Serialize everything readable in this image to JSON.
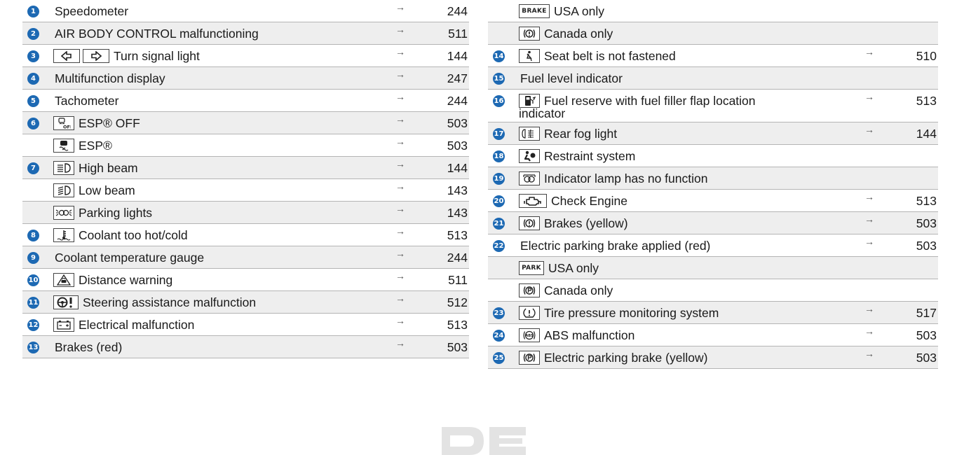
{
  "left": [
    {
      "num": "1",
      "label": "Speedometer",
      "page": "244",
      "shade": false,
      "icons": []
    },
    {
      "num": "2",
      "label": "AIR BODY CONTROL malfunctioning",
      "page": "511",
      "shade": true,
      "icons": []
    },
    {
      "num": "3",
      "label": "Turn signal light",
      "page": "144",
      "shade": false,
      "icons": [
        "turn-left-icon",
        "turn-right-icon"
      ]
    },
    {
      "num": "4",
      "label": "Multifunction display",
      "page": "247",
      "shade": true,
      "icons": []
    },
    {
      "num": "5",
      "label": "Tachometer",
      "page": "244",
      "shade": false,
      "icons": []
    },
    {
      "num": "6",
      "label": "ESP® OFF",
      "page": "503",
      "shade": true,
      "icons": [
        "esp-off-icon"
      ]
    },
    {
      "num": "",
      "label": "ESP®",
      "page": "503",
      "shade": false,
      "icons": [
        "esp-icon"
      ]
    },
    {
      "num": "7",
      "label": "High beam",
      "page": "144",
      "shade": true,
      "icons": [
        "high-beam-icon"
      ]
    },
    {
      "num": "",
      "label": "Low beam",
      "page": "143",
      "shade": false,
      "icons": [
        "low-beam-icon"
      ]
    },
    {
      "num": "",
      "label": "Parking lights",
      "page": "143",
      "shade": true,
      "icons": [
        "parking-lights-icon"
      ]
    },
    {
      "num": "8",
      "label": "Coolant too hot/cold",
      "page": "513",
      "shade": false,
      "icons": [
        "coolant-icon"
      ]
    },
    {
      "num": "9",
      "label": "Coolant temperature gauge",
      "page": "244",
      "shade": true,
      "icons": []
    },
    {
      "num": "10",
      "label": "Distance warning",
      "page": "511",
      "shade": false,
      "icons": [
        "distance-warning-icon"
      ]
    },
    {
      "num": "11",
      "label": "Steering assistance malfunction",
      "page": "512",
      "shade": true,
      "icons": [
        "steering-icon"
      ]
    },
    {
      "num": "12",
      "label": "Electrical malfunction",
      "page": "513",
      "shade": false,
      "icons": [
        "battery-icon"
      ]
    },
    {
      "num": "13",
      "label": "Brakes (red)",
      "page": "503",
      "shade": true,
      "icons": []
    }
  ],
  "right": [
    {
      "num": "",
      "label": "USA only",
      "page": "",
      "shade": false,
      "icons": [
        "brake-text-icon"
      ]
    },
    {
      "num": "",
      "label": "Canada only",
      "page": "",
      "shade": true,
      "icons": [
        "brake-circle-icon"
      ]
    },
    {
      "num": "14",
      "label": "Seat belt is not fastened",
      "page": "510",
      "shade": false,
      "icons": [
        "seat-belt-icon"
      ]
    },
    {
      "num": "15",
      "label": "Fuel level indicator",
      "page": "",
      "shade": true,
      "icons": []
    },
    {
      "num": "16",
      "label": "Fuel reserve with fuel filler flap location",
      "label2": "indicator",
      "page": "513",
      "shade": false,
      "icons": [
        "fuel-icon"
      ]
    },
    {
      "num": "17",
      "label": "Rear fog light",
      "page": "144",
      "shade": true,
      "icons": [
        "rear-fog-icon"
      ]
    },
    {
      "num": "18",
      "label": "Restraint system",
      "page": "",
      "shade": false,
      "icons": [
        "restraint-icon"
      ]
    },
    {
      "num": "19",
      "label": "Indicator lamp has no function",
      "page": "",
      "shade": true,
      "icons": [
        "indicator-lamp-icon"
      ]
    },
    {
      "num": "20",
      "label": "Check Engine",
      "page": "513",
      "shade": false,
      "icons": [
        "engine-icon"
      ]
    },
    {
      "num": "21",
      "label": "Brakes (yellow)",
      "page": "503",
      "shade": true,
      "icons": [
        "brake-circle-icon"
      ]
    },
    {
      "num": "22",
      "label": "Electric parking brake applied (red)",
      "page": "503",
      "shade": false,
      "icons": []
    },
    {
      "num": "",
      "label": "USA only",
      "page": "",
      "shade": true,
      "icons": [
        "park-text-icon"
      ]
    },
    {
      "num": "",
      "label": "Canada only",
      "page": "",
      "shade": false,
      "icons": [
        "park-circle-icon"
      ]
    },
    {
      "num": "23",
      "label": "Tire pressure monitoring system",
      "page": "517",
      "shade": true,
      "icons": [
        "tire-pressure-icon"
      ]
    },
    {
      "num": "24",
      "label": "ABS malfunction",
      "page": "503",
      "shade": false,
      "icons": [
        "abs-icon"
      ]
    },
    {
      "num": "25",
      "label": "Electric parking brake (yellow)",
      "page": "503",
      "shade": true,
      "icons": [
        "park-circle-icon"
      ]
    }
  ],
  "arrow_glyph": "→",
  "icon_text": {
    "brake_word": "BRAKE",
    "park_word": "PARK"
  },
  "colors": {
    "number_badge": "#1d69b3",
    "row_shade": "#eeeeee",
    "rule": "#b4b4b4"
  }
}
